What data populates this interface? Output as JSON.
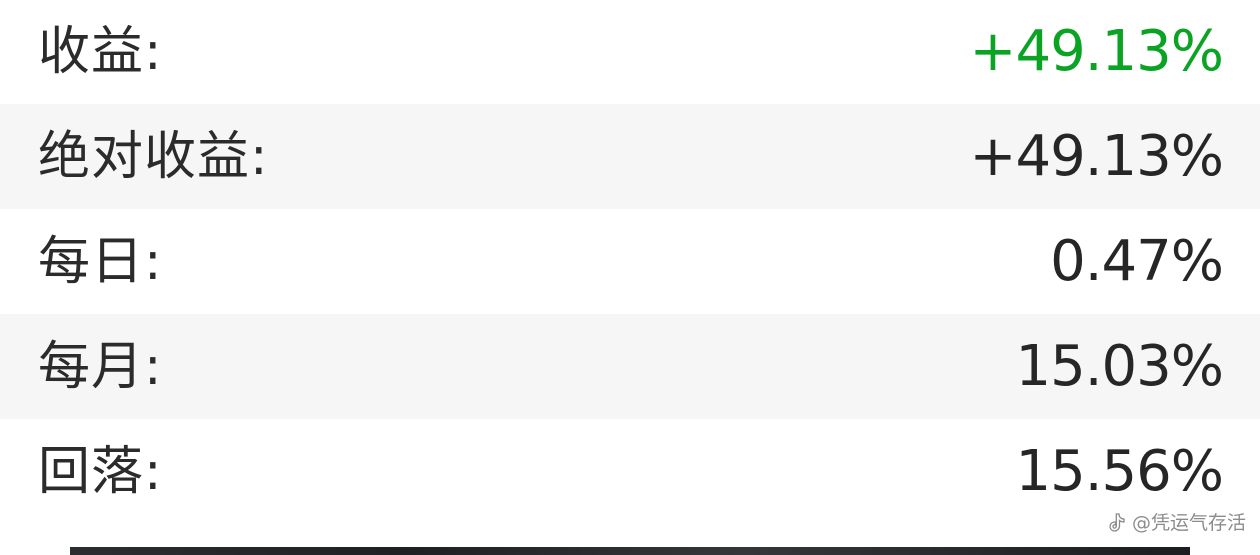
{
  "stats": [
    {
      "label": "收益:",
      "value": "+49.13%",
      "color": "#0aa324"
    },
    {
      "label": "绝对收益:",
      "value": "+49.13%",
      "color": "#262626"
    },
    {
      "label": "每日:",
      "value": "0.47%",
      "color": "#262626"
    },
    {
      "label": "每月:",
      "value": "15.03%",
      "color": "#262626"
    },
    {
      "label": "回落:",
      "value": "15.56%",
      "color": "#262626"
    }
  ],
  "watermark": {
    "text": "@凭运气存活",
    "icon": "music-note-icon"
  }
}
